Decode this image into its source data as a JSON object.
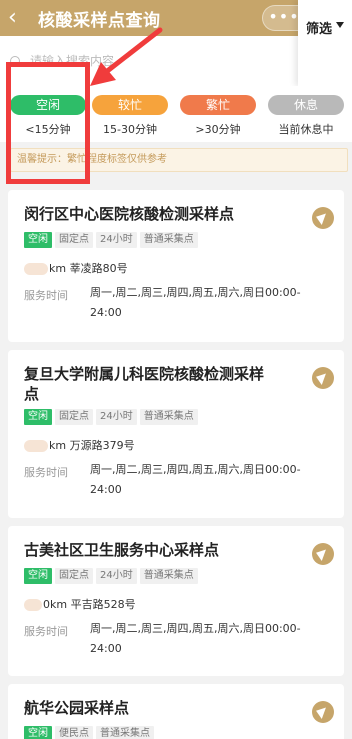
{
  "header": {
    "back_icon": "back-chevron-icon",
    "title": "核酸采样点查询",
    "more_icon": "more-dots-icon",
    "close_icon": "record-icon"
  },
  "search": {
    "placeholder": "请输入搜索内容",
    "filter_label": "筛选"
  },
  "legend": [
    {
      "label": "空闲",
      "desc": "<15分钟",
      "color": "#2ebd68"
    },
    {
      "label": "较忙",
      "desc": "15-30分钟",
      "color": "#f6a33c"
    },
    {
      "label": "繁忙",
      "desc": ">30分钟",
      "color": "#f07a4b"
    },
    {
      "label": "休息",
      "desc": "当前休息中",
      "color": "#b9b9b9"
    }
  ],
  "tip": "温馨提示：繁忙程度标签仅供参考",
  "cards": [
    {
      "name": "闵行区中心医院核酸检测采样点",
      "tags": [
        "空闲",
        "固定点",
        "24小时",
        "普通采集点"
      ],
      "dist_unit": "km",
      "address": "莘凌路80号",
      "service_label": "服务时间",
      "service_time": "周一,周二,周三,周四,周五,周六,周日00:00-24:00"
    },
    {
      "name": "复旦大学附属儿科医院核酸检测采样点",
      "tags": [
        "空闲",
        "固定点",
        "24小时",
        "普通采集点"
      ],
      "dist_unit": "km",
      "address": "万源路379号",
      "service_label": "服务时间",
      "service_time": "周一,周二,周三,周四,周五,周六,周日00:00-24:00"
    },
    {
      "name": "古美社区卫生服务中心采样点",
      "tags": [
        "空闲",
        "固定点",
        "24小时",
        "普通采集点"
      ],
      "dist_unit": "0km",
      "address": "平吉路528号",
      "service_label": "服务时间",
      "service_time": "周一,周二,周三,周四,周五,周六,周日00:00-24:00"
    },
    {
      "name": "航华公园采样点",
      "tags": [
        "空闲",
        "便民点",
        "普通采集点"
      ]
    }
  ],
  "annotation": {
    "highlight_color": "#f03c3c"
  }
}
